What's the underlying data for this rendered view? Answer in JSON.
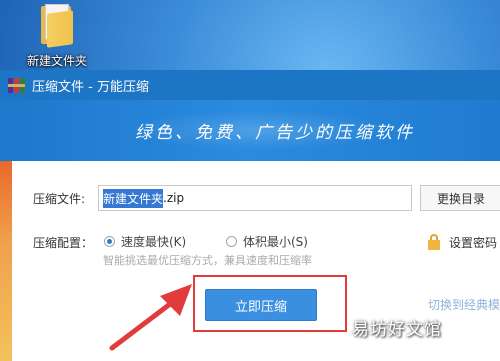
{
  "desktop": {
    "folder_label": "新建文件夹"
  },
  "window": {
    "title": "压缩文件 - 万能压缩",
    "slogan": "绿色、免费、广告少的压缩软件"
  },
  "form": {
    "file_label": "压缩文件:",
    "file_name_selected": "新建文件夹",
    "file_ext": ".zip",
    "change_dir_label": "更换目录",
    "config_label": "压缩配置：",
    "option_fast": "速度最快(K)",
    "option_small": "体积最小(S)",
    "selected_option": "fast",
    "hint": "智能挑选最优压缩方式，兼具速度和压缩率",
    "set_password_label": "设置密码",
    "compress_button": "立即压缩",
    "switch_link": "切换到经典模"
  },
  "colors": {
    "titlebar": "#1d75c6",
    "button": "#3b8fe0",
    "highlight": "#e23b3b"
  },
  "watermark": "易坊好文馆"
}
